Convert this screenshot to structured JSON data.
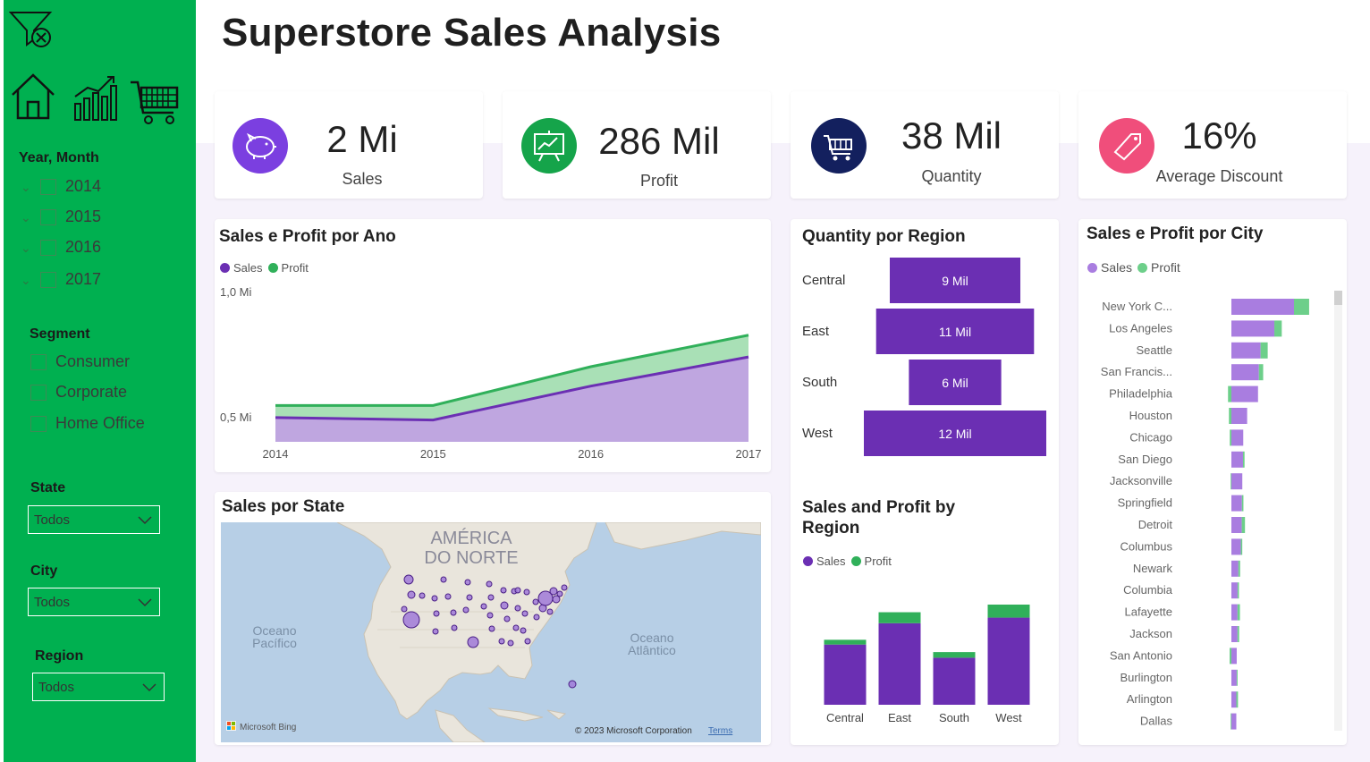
{
  "header": {
    "title": "Superstore Sales Analysis"
  },
  "sidebar": {
    "icons": [
      "clear-filter-icon",
      "home-icon",
      "chart-icon",
      "cart-icon"
    ],
    "year_month": {
      "title": "Year, Month",
      "items": [
        "2014",
        "2015",
        "2016",
        "2017"
      ]
    },
    "segment": {
      "title": "Segment",
      "items": [
        "Consumer",
        "Corporate",
        "Home Office"
      ]
    },
    "state": {
      "title": "State",
      "value": "Todos"
    },
    "city": {
      "title": "City",
      "value": "Todos"
    },
    "region": {
      "title": "Region",
      "value": "Todos"
    }
  },
  "kpis": [
    {
      "value": "2 Mi",
      "label": "Sales",
      "icon": "piggy-bank-icon",
      "color": "#7b3fe0"
    },
    {
      "value": "286 Mil",
      "label": "Profit",
      "icon": "presentation-chart-icon",
      "color": "#15a44a"
    },
    {
      "value": "38 Mil",
      "label": "Quantity",
      "icon": "cart-icon",
      "color": "#13205e"
    },
    {
      "value": "16%",
      "label": "Average Discount",
      "icon": "tag-icon",
      "color": "#f04e7b"
    }
  ],
  "colors": {
    "sales": "#6b2fb3",
    "sales_fill": "#bfa6e0",
    "profit": "#30b05a",
    "profit_fill": "#a9e0b6",
    "bar_purple": "#6b2fb3"
  },
  "chart_data": [
    {
      "type": "area",
      "title": "Sales e Profit por Ano",
      "x": [
        "2014",
        "2015",
        "2016",
        "2017"
      ],
      "ytick_labels": [
        "1,0 Mi",
        "0,5 Mi"
      ],
      "series": [
        {
          "name": "Sales",
          "values": [
            0.48,
            0.47,
            0.61,
            0.73
          ]
        },
        {
          "name": "Profit",
          "values": [
            0.05,
            0.06,
            0.08,
            0.09
          ]
        }
      ],
      "ylim": [
        0.38,
        1.0
      ],
      "legend": "top-left"
    },
    {
      "type": "bar",
      "title": "Quantity por Region",
      "categories": [
        "Central",
        "East",
        "South",
        "West"
      ],
      "values": [
        8780,
        10618,
        6209,
        12266
      ],
      "labels": [
        "9 Mil",
        "11 Mil",
        "6 Mil",
        "12 Mil"
      ]
    },
    {
      "type": "bar",
      "title": "Sales and Profit by Region",
      "categories": [
        "Central",
        "East",
        "South",
        "West"
      ],
      "series": [
        {
          "name": "Sales",
          "values": [
            501240,
            678781,
            391722,
            725458
          ]
        },
        {
          "name": "Profit",
          "values": [
            39706,
            91523,
            46749,
            108418
          ]
        }
      ],
      "legend": "top-left"
    },
    {
      "type": "bar",
      "title": "Sales e Profit por City",
      "categories": [
        "New York C...",
        "Los Angeles",
        "Seattle",
        "San Francis...",
        "Philadelphia",
        "Houston",
        "Chicago",
        "San Diego",
        "Jacksonville",
        "Springfield",
        "Detroit",
        "Columbus",
        "Newark",
        "Columbia",
        "Lafayette",
        "Jackson",
        "San Antonio",
        "Burlington",
        "Arlington",
        "Dallas"
      ],
      "series": [
        {
          "name": "Sales",
          "values": [
            256368,
            175851,
            119541,
            112669,
            109077,
            64505,
            48540,
            47521,
            44713,
            43054,
            42447,
            38662,
            28576,
            25283,
            25036,
            24964,
            21844,
            21668,
            20214,
            20132
          ]
        },
        {
          "name": "Profit",
          "values": [
            62037,
            30441,
            29156,
            17507,
            -13838,
            -10154,
            -6655,
            6377,
            -3012,
            6200,
            13181,
            5897,
            7208,
            5606,
            10018,
            6792,
            -7300,
            3667,
            6860,
            -2847
          ]
        }
      ],
      "legend": "top-left"
    }
  ],
  "titles": {
    "area": "Sales e Profit por Ano",
    "map": "Sales por State",
    "quantity": "Quantity por Region",
    "sales_profit_region": "Sales and Profit by Region",
    "city": "Sales e Profit por City"
  },
  "legend": {
    "sales": "Sales",
    "profit": "Profit"
  },
  "map": {
    "labels": [
      "AMÉRICA",
      "DO NORTE",
      "Oceano",
      "Pacífico",
      "Oceano",
      "Atlântico"
    ],
    "copyright": "© 2023 Microsoft Corporation",
    "terms": "Terms",
    "brand": "Microsoft Bing"
  }
}
